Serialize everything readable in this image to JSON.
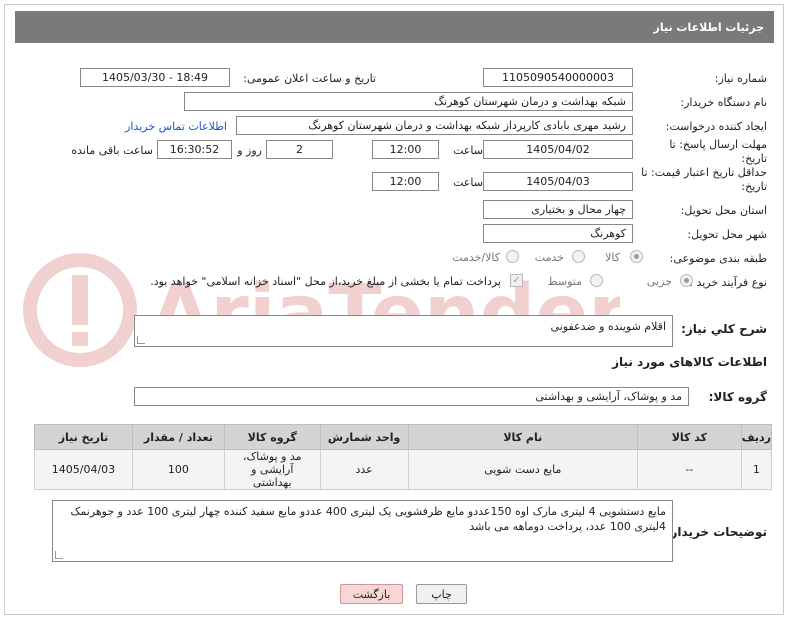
{
  "header": {
    "title": "جزئیات اطلاعات نیاز"
  },
  "form": {
    "need_number_label": "شماره نیاز:",
    "need_number": "1105090540000003",
    "announce_label": "تاریخ و ساعت اعلان عمومی:",
    "announce_value": "1405/03/30 - 18:49",
    "buyer_label": "نام دستگاه خریدار:",
    "buyer_value": "شبکه بهداشت و درمان شهرستان کوهرنگ",
    "requester_label": "ایجاد کننده درخواست:",
    "requester_value": "رشید مهری بابادی کارپرداز شبکه بهداشت و درمان شهرستان کوهرنگ",
    "contact_link": "اطلاعات تماس خریدار",
    "deadline_label": "مهلت ارسال پاسخ: تا تاریخ:",
    "deadline_date": "1405/04/02",
    "hour_label": "ساعت",
    "deadline_time": "12:00",
    "days_value": "2",
    "days_label": "روز و",
    "remaining_time": "16:30:52",
    "remaining_label": "ساعت باقی مانده",
    "validity_label": "حداقل تاریخ اعتبار قیمت: تا تاریخ:",
    "validity_date": "1405/04/03",
    "validity_time": "12:00",
    "province_label": "استان محل تحویل:",
    "province_value": "چهار محال و بختیاری",
    "city_label": "شهر محل تحویل:",
    "city_value": "کوهرنگ",
    "category_label": "طبقه بندی موضوعی:",
    "category_options": [
      "کالا",
      "خدمت",
      "کالا/خدمت"
    ],
    "process_label": "نوع فرآیند خرید :",
    "process_options": [
      "جزیی",
      "متوسط"
    ],
    "payment_note": "پرداخت تمام یا بخشی از مبلغ خرید،از محل \"اسناد خزانه اسلامی\" خواهد بود."
  },
  "description": {
    "label": "شرح کلي نياز:",
    "value": "اقلام شوینده و ضدعفونی"
  },
  "goods": {
    "section_title": "اطلاعات کالاهای مورد نیاز",
    "group_label": "گروه کالا:",
    "group_value": "مد و پوشاک، آرایشی و بهداشتی",
    "columns": [
      "ردیف",
      "کد کالا",
      "نام کالا",
      "واحد شمارش",
      "گروه کالا",
      "تعداد / مقدار",
      "تاریخ نیاز"
    ],
    "rows": [
      [
        "1",
        "--",
        "مایع دست شویی",
        "عدد",
        "مد و پوشاک، آرایشی و بهداشتی",
        "100",
        "1405/04/03"
      ]
    ]
  },
  "buyer_notes": {
    "label": "توضیحات خریدار:",
    "value": "مایع دستشویی 4 لیتری مارک اوه 150عددو مایع ظرفشویی یک لیتری 400 عددو مایع سفید کننده چهار لیتری 100 عدد و جوهرنمک 4لیتری 100 عدد، پرداخت دوماهه می باشد"
  },
  "buttons": {
    "print": "چاپ",
    "back": "بازگشت"
  },
  "watermark": "AriaTender.net",
  "colors": {
    "header_bg": "#7a7a7a",
    "link": "#1a56c9",
    "back_button": "#f7d6d6"
  }
}
